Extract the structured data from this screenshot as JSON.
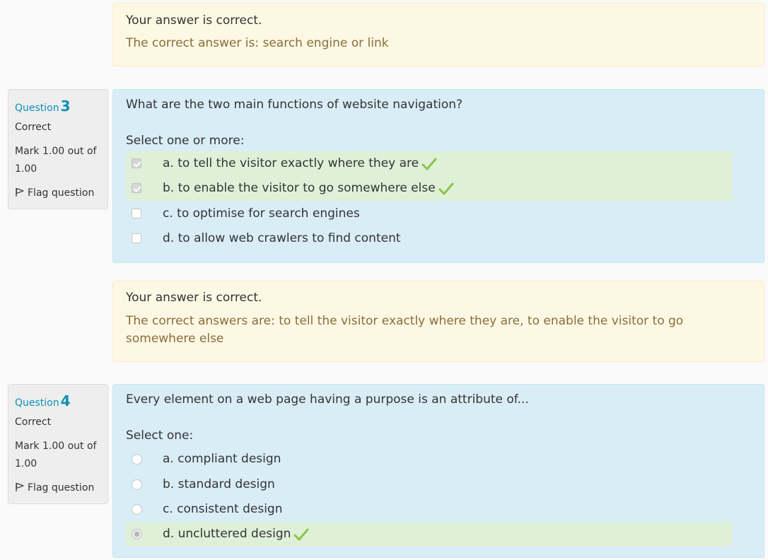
{
  "feedback_q2": {
    "status": "Your answer is correct.",
    "right_answer": "The correct answer is: search engine or link"
  },
  "q3": {
    "label": "Question",
    "number": "3",
    "state": "Correct",
    "grade": "Mark 1.00 out of 1.00",
    "flag": "Flag question",
    "text": "What are the two main functions of website navigation?",
    "prompt": "Select one or more:",
    "options": [
      {
        "label": "a. to tell the visitor exactly where they are",
        "checked": true,
        "correct": true
      },
      {
        "label": "b. to enable the visitor to go somewhere else",
        "checked": true,
        "correct": true
      },
      {
        "label": "c. to optimise for search engines",
        "checked": false,
        "correct": false
      },
      {
        "label": "d. to allow web crawlers to find content",
        "checked": false,
        "correct": false
      }
    ]
  },
  "feedback_q3": {
    "status": "Your answer is correct.",
    "right_answer": "The correct answers are: to tell the visitor exactly where they are, to enable the visitor to go somewhere else"
  },
  "q4": {
    "label": "Question",
    "number": "4",
    "state": "Correct",
    "grade": "Mark 1.00 out of 1.00",
    "flag": "Flag question",
    "text": "Every element on a web page having a purpose is an attribute of...",
    "prompt": "Select one:",
    "options": [
      {
        "label": "a. compliant design",
        "checked": false,
        "correct": false
      },
      {
        "label": "b. standard design",
        "checked": false,
        "correct": false
      },
      {
        "label": "c. consistent design",
        "checked": false,
        "correct": false
      },
      {
        "label": "d. uncluttered design",
        "checked": true,
        "correct": true
      }
    ]
  },
  "colors": {
    "feedback_bg": "#fcf8e3",
    "content_bg": "#d9edf7",
    "correct_option_bg": "#dff0d8",
    "tick": "#8bc34a",
    "question_label": "#0f8fb6"
  }
}
